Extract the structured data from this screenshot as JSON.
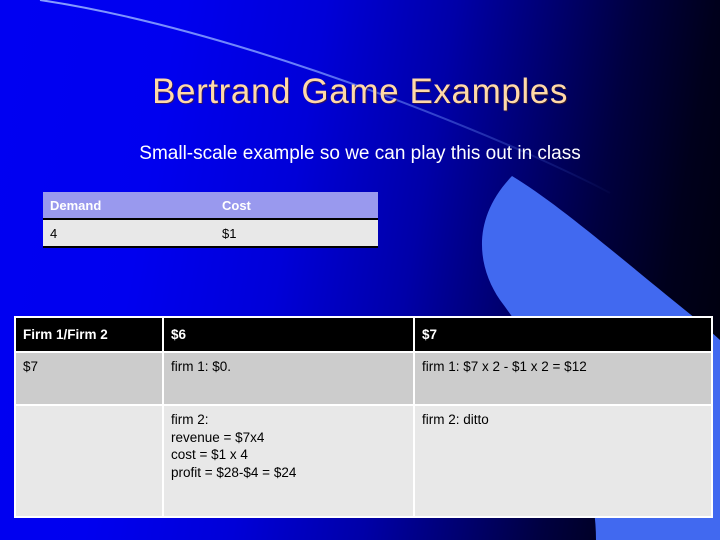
{
  "slide": {
    "title": "Bertrand Game Examples",
    "subtitle": "Small-scale example so we can play this out in class",
    "colors": {
      "title_text": "#ffd9a8",
      "subtitle_text": "#ffffff",
      "background_left": "#0000f2",
      "background_right": "#000008",
      "swoosh_band": "#4169f0",
      "arc_line": "#6f8cf5",
      "table1_header_bg": "#9999ee",
      "table1_body_bg": "#e8e8e8",
      "table2_header_bg": "#000000",
      "table2_row1_bg": "#cccccc",
      "table2_row2_bg": "#e8e8e8"
    }
  },
  "table_demand_cost": {
    "headers": [
      "Demand",
      "Cost"
    ],
    "rows": [
      [
        "4",
        "$1"
      ]
    ]
  },
  "table_payoff": {
    "headers": [
      "Firm 1/Firm 2",
      "$6",
      "$7"
    ],
    "rows": [
      [
        "$7",
        "firm 1: $0.",
        "firm 1: $7 x 2 - $1 x 2 = $12"
      ],
      [
        "",
        "firm 2:\nrevenue = $7x4\ncost = $1 x 4\nprofit = $28-$4 = $24",
        "firm 2: ditto"
      ]
    ]
  }
}
